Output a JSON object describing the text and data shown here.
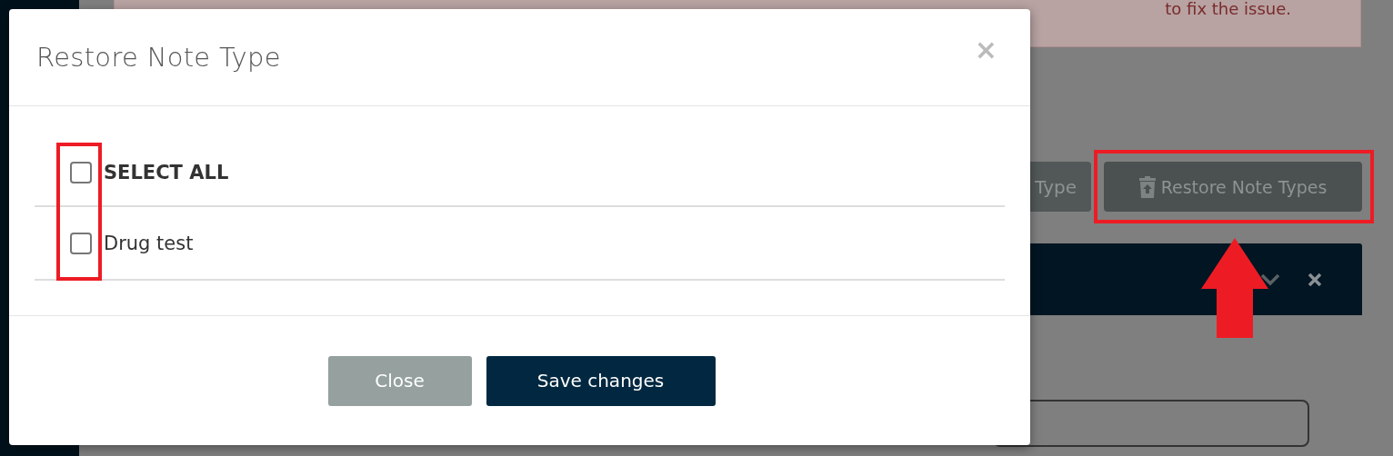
{
  "alert": {
    "text": "to fix the issue."
  },
  "toolbar": {
    "buttons": [
      {
        "label": "Type",
        "kind": "partial"
      },
      {
        "label": "Restore Note Types",
        "kind": "restore"
      }
    ]
  },
  "modal": {
    "title": "Restore Note Type",
    "close_symbol": "×",
    "items": [
      {
        "label": "SELECT ALL",
        "kind": "all",
        "checked": false
      },
      {
        "label": "Drug test",
        "kind": "item",
        "checked": false
      }
    ],
    "buttons": [
      {
        "label": "Close",
        "kind": "secondary"
      },
      {
        "label": "Save changes",
        "kind": "primary"
      }
    ]
  }
}
